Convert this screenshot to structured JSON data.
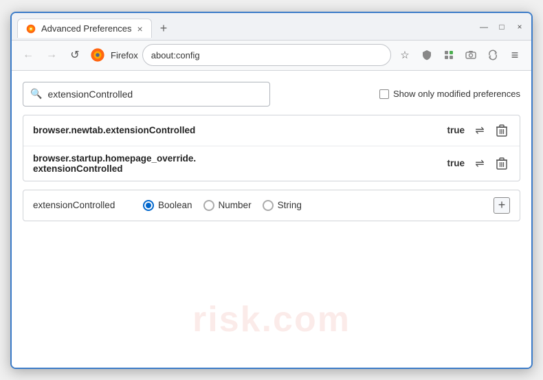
{
  "window": {
    "title": "Advanced Preferences",
    "tab_label": "Advanced Preferences",
    "close_btn": "×",
    "min_btn": "—",
    "max_btn": "□",
    "new_tab_btn": "+"
  },
  "nav": {
    "back_icon": "←",
    "forward_icon": "→",
    "reload_icon": "↺",
    "browser_name": "Firefox",
    "address": "about:config",
    "bookmark_icon": "☆",
    "shield_icon": "⛉",
    "extension_icon": "⬛",
    "screenshot_icon": "⬛",
    "sync_icon": "⬛",
    "menu_icon": "≡"
  },
  "search": {
    "placeholder": "extensionControlled",
    "value": "extensionControlled",
    "show_modified_label": "Show only modified preferences"
  },
  "results": [
    {
      "name": "browser.newtab.extensionControlled",
      "value": "true",
      "id": "row1"
    },
    {
      "name1": "browser.startup.homepage_override.",
      "name2": "extensionControlled",
      "value": "true",
      "id": "row2"
    }
  ],
  "new_pref": {
    "name": "extensionControlled",
    "types": [
      {
        "label": "Boolean",
        "selected": true
      },
      {
        "label": "Number",
        "selected": false
      },
      {
        "label": "String",
        "selected": false
      }
    ],
    "add_btn": "+"
  },
  "watermark": "risk.com",
  "icons": {
    "swap": "⇌",
    "trash": "🗑"
  }
}
